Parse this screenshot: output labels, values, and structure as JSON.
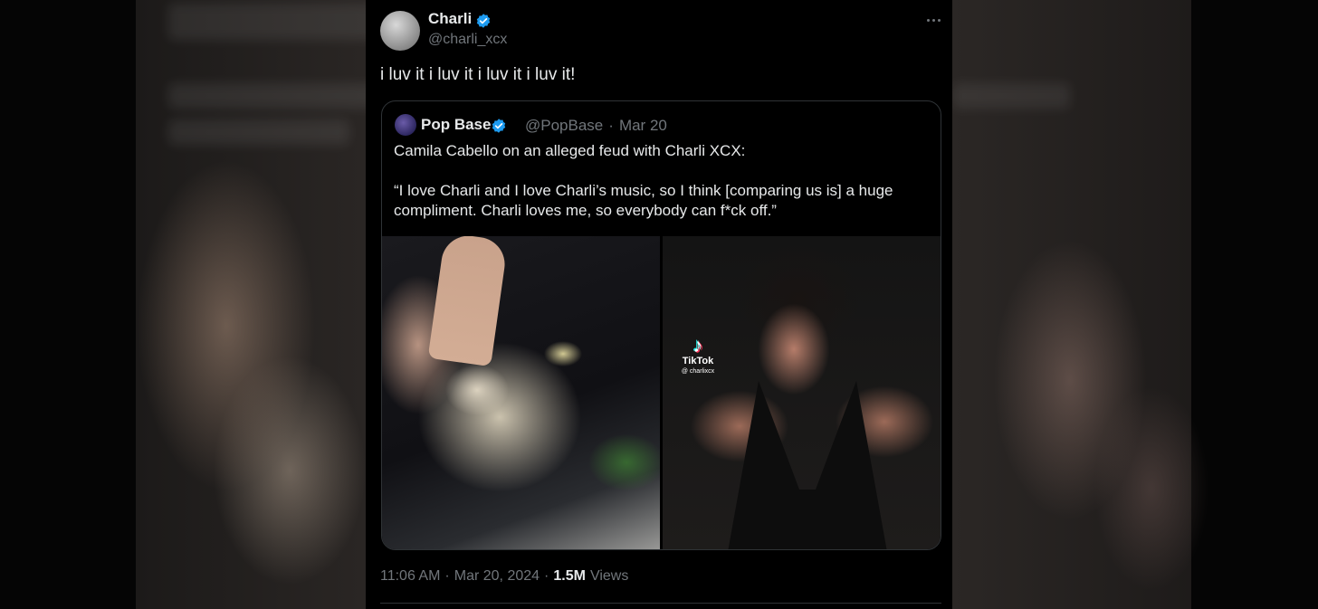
{
  "tweet": {
    "author": {
      "display_name": "Charli",
      "handle": "@charli_xcx",
      "avatar_icon": "avatar-photo",
      "verified_icon": "verified-badge-icon"
    },
    "more_icon": "more-horizontal-icon",
    "text": "i luv it i luv it i luv it i luv it!",
    "quoted": {
      "display_name": "Pop Base",
      "handle": "@PopBase",
      "separator": "·",
      "date": "Mar 20",
      "paragraph_1": "Camila Cabello on an alleged feud with Charli XCX:",
      "paragraph_2": "“I love Charli and I love Charli’s music, so I think [comparing us is] a huge compliment. Charli loves me, so everybody can f*ck off.”",
      "media": {
        "tiktok_wordmark": "TikTok",
        "tiktok_handle": "@ charlixcx",
        "tiktok_icon": "tiktok-logo-icon"
      }
    },
    "footer": {
      "time": "11:06 AM",
      "sep1": "·",
      "date": "Mar 20, 2024",
      "sep2": "·",
      "views_count": "1.5M",
      "views_label": "Views"
    }
  },
  "colors": {
    "background": "#000000",
    "text_primary": "#e7e9ea",
    "text_secondary": "#71767b",
    "verified_blue": "#1d9bf0",
    "border": "#2f3336"
  }
}
